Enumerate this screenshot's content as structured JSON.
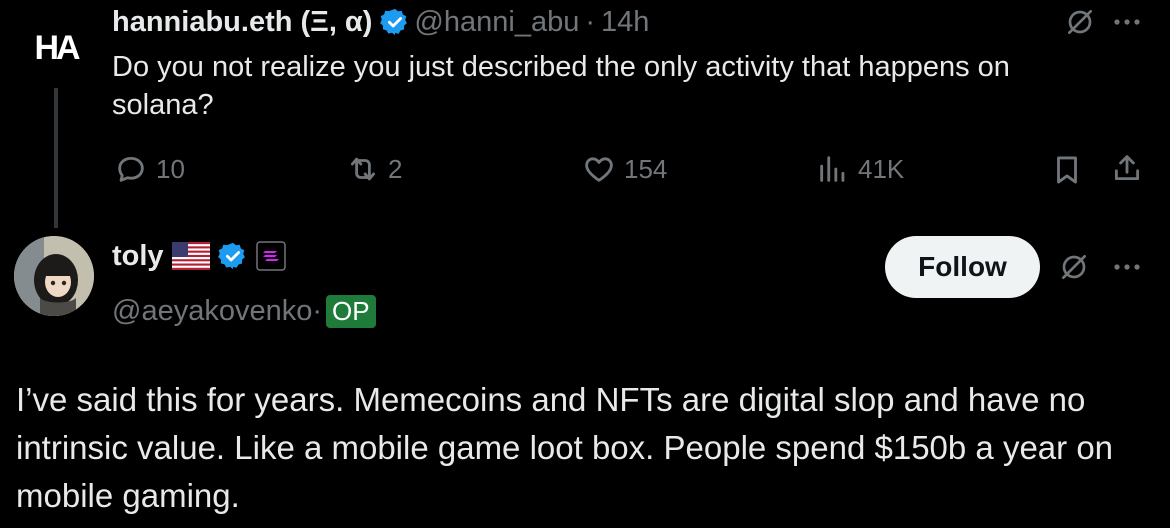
{
  "parent_tweet": {
    "author_name": "hanniabu.eth (Ξ, α)",
    "handle": "@hanni_abu",
    "separator": "·",
    "time": "14h",
    "avatar_text": "HA",
    "text": "Do you not realize you just described the only activity that happens on solana?",
    "replies": "10",
    "reposts": "2",
    "likes": "154",
    "views": "41K"
  },
  "reply_tweet": {
    "author_name": "toly",
    "handle": "@aeyakovenko",
    "separator": "·",
    "op_badge": "OP",
    "follow_label": "Follow",
    "text": "I’ve said this for years.  Memecoins and NFTs are digital slop and have no intrinsic value.  Like a mobile game loot box.  People spend $150b a year on mobile gaming."
  },
  "colors": {
    "background": "#000000",
    "verified_blue": "#1d9bf0",
    "op_green": "#1e7b3a",
    "muted": "#71767b"
  }
}
